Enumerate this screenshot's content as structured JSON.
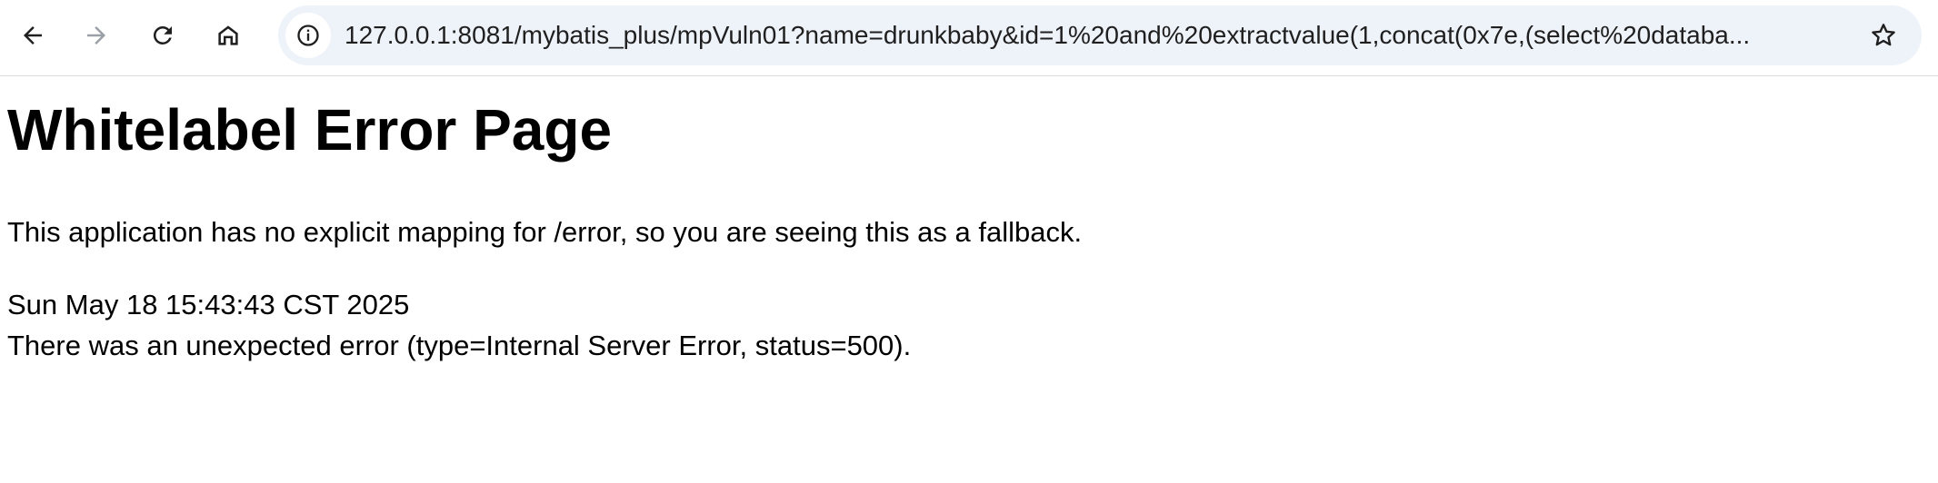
{
  "browser": {
    "url": "127.0.0.1:8081/mybatis_plus/mpVuln01?name=drunkbaby&id=1%20and%20extractvalue(1,concat(0x7e,(select%20databa...",
    "icons": {
      "back": "back-arrow-icon",
      "forward": "forward-arrow-icon",
      "reload": "reload-icon",
      "home": "home-icon",
      "site_info": "info-icon",
      "bookmark": "star-icon"
    }
  },
  "page": {
    "title": "Whitelabel Error Page",
    "message": "This application has no explicit mapping for /error, so you are seeing this as a fallback.",
    "timestamp": "Sun May 18 15:43:43 CST 2025",
    "error": "There was an unexpected error (type=Internal Server Error, status=500)."
  }
}
